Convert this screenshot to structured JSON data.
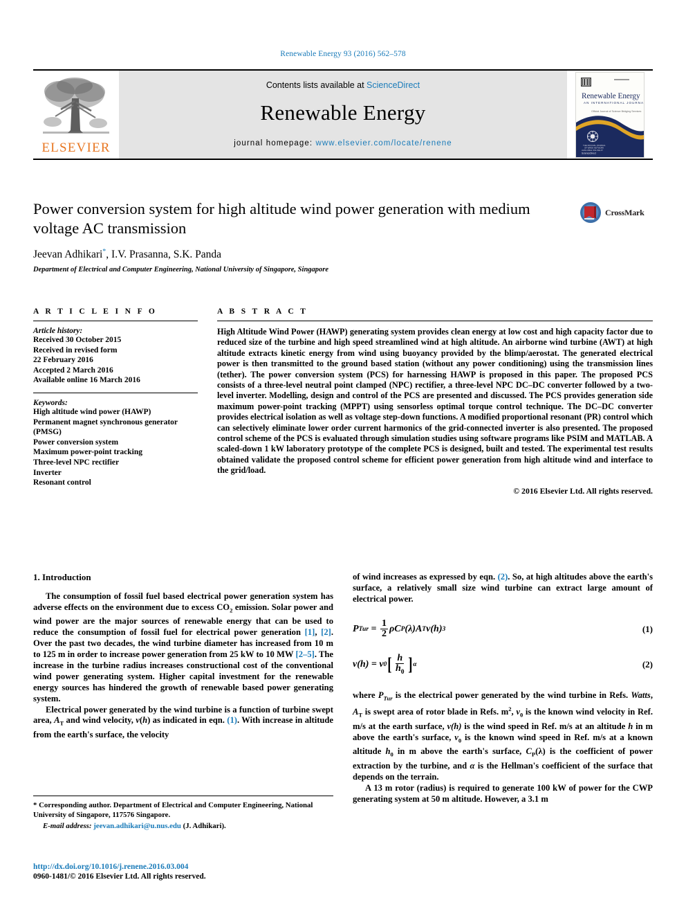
{
  "running_head": "Renewable Energy 93 (2016) 562–578",
  "masthead": {
    "contents_prefix": "Contents lists available at ",
    "sciencedirect": "ScienceDirect",
    "journal_title": "Renewable Energy",
    "homepage_prefix": "journal homepage: ",
    "homepage_url": "www.elsevier.com/locate/renene",
    "publisher_wordmark": "ELSEVIER",
    "cover": {
      "title": "Renewable Energy",
      "subtitle": "AN INTERNATIONAL JOURNAL",
      "tagline": "Official Journal of WREN — Science Bridging Services"
    }
  },
  "article": {
    "title": "Power conversion system for high altitude wind power generation with medium voltage AC transmission",
    "authors": "Jeevan Adhikari, I.V. Prasanna, S.K. Panda",
    "author_list": [
      {
        "name": "Jeevan Adhikari",
        "corresponding_marker": "*"
      },
      {
        "name": "I.V. Prasanna"
      },
      {
        "name": "S.K. Panda"
      }
    ],
    "affiliation": "Department of Electrical and Computer Engineering, National University of Singapore, Singapore",
    "crossmark_label": "CrossMark"
  },
  "article_info": {
    "heading": "A R T I C L E   I N F O",
    "history_heading": "Article history:",
    "history": [
      "Received 30 October 2015",
      "Received in revised form",
      "22 February 2016",
      "Accepted 2 March 2016",
      "Available online 16 March 2016"
    ],
    "keywords_heading": "Keywords:",
    "keywords": [
      "High altitude wind power (HAWP)",
      "Permanent magnet synchronous generator (PMSG)",
      "Power conversion system",
      "Maximum power-point tracking",
      "Three-level NPC rectifier",
      "Inverter",
      "Resonant control"
    ]
  },
  "abstract": {
    "heading": "A B S T R A C T",
    "text": "High Altitude Wind Power (HAWP) generating system provides clean energy at low cost and high capacity factor due to reduced size of the turbine and high speed streamlined wind at high altitude. An airborne wind turbine (AWT) at high altitude extracts kinetic energy from wind using buoyancy provided by the blimp/aerostat. The generated electrical power is then transmitted to the ground based station (without any power conditioning) using the transmission lines (tether). The power conversion system (PCS) for harnessing HAWP is proposed in this paper. The proposed PCS consists of a three-level neutral point clamped (NPC) rectifier, a three-level NPC DC–DC converter followed by a two-level inverter. Modelling, design and control of the PCS are presented and discussed. The PCS provides generation side maximum power-point tracking (MPPT) using sensorless optimal torque control technique. The DC–DC converter provides electrical isolation as well as voltage step-down functions. A modified proportional resonant (PR) control which can selectively eliminate lower order current harmonics of the grid-connected inverter is also presented. The proposed control scheme of the PCS is evaluated through simulation studies using software programs like PSIM and MATLAB. A scaled-down 1 kW laboratory prototype of the complete PCS is designed, built and tested. The experimental test results obtained validate the proposed control scheme for efficient power generation from high altitude wind and interface to the grid/load.",
    "copyright": "© 2016 Elsevier Ltd. All rights reserved."
  },
  "body": {
    "section_heading": "1. Introduction",
    "left_para_1_a": "The consumption of fossil fuel based electrical power generation system has adverse effects on the environment due to excess CO",
    "left_para_1_sub": "2",
    "left_para_1_b": " emission. Solar power and wind power are the major sources of renewable energy that can be used to reduce the consumption of fossil fuel for electrical power generation ",
    "ref_1": "[1]",
    "ref_sep": ", ",
    "ref_2": "[2]",
    "left_para_1_c": ". Over the past two decades, the wind turbine diameter has increased from 10 m to 125 m in order to increase power generation from 25 kW to 10 MW ",
    "ref_2_5": "[2–5]",
    "left_para_1_d": ". The increase in the turbine radius increases constructional cost of the conventional wind power generating system. Higher capital investment for the renewable energy sources has hindered the growth of renewable based power generating system.",
    "left_para_2_a": "Electrical power generated by the wind turbine is a function of turbine swept area, ",
    "left_para_2_b": " and wind velocity, ",
    "left_para_2_c": " as indicated in eqn. ",
    "ref_eq1": "(1)",
    "left_para_2_d": ". With increase in altitude from the earth's surface, the velocity",
    "right_para_1_a": "of wind increases as expressed by eqn. ",
    "ref_eq2": "(2)",
    "right_para_1_b": ". So, at high altitudes above the earth's surface, a relatively small size wind turbine can extract large amount of electrical power.",
    "right_para_where": "where P",
    "right_para_2": "A 13 m rotor (radius) is required to generate 100 kW of power for the CWP generating system at 50 m altitude. However, a 3.1 m"
  },
  "equations": [
    {
      "number": "(1)",
      "lhs": "P",
      "lhs_sub": "Tur",
      "rhs_text": "= ½ρC_P(λ)A_T v(h)³"
    },
    {
      "number": "(2)",
      "lhs": "v(h)",
      "rhs_text": "= v₀[h/h₀]^α"
    }
  ],
  "nomenclature": {
    "intro": "where ",
    "p_tur": "P",
    "p_tur_sub": "Tur",
    "t1": " is the electrical power generated by the wind turbine in Refs. ",
    "watts": "Watts",
    "t2": ", ",
    "a_t": "A",
    "a_t_sub": "T",
    "t3": " is swept area of rotor blade in Refs. m",
    "sup2": "2",
    "t4": ", ",
    "v0": "v",
    "v0_sub": "0",
    "t5": " is the known wind velocity in Ref. m/s at the earth surface, ",
    "vh": "v(h)",
    "t6": " is the wind speed in Ref. m/s at an altitude ",
    "h": "h",
    "t7": " in m above the earth's surface, ",
    "v0b": "v",
    "v0b_sub": "0",
    "t8": " is the known wind speed in Ref. m/s at a known altitude ",
    "h0": "h",
    "h0_sub": "0",
    "t9": " in m above the earth's surface, ",
    "cp": "C",
    "cp_sub": "P",
    "cp_arg": "(λ)",
    "t10": " is the coefficient of power extraction by the turbine, and ",
    "alpha": "α",
    "t11": " is the Hellman's coefficient of the surface that depends on the terrain."
  },
  "footnotes": {
    "corresponding": "* Corresponding author. Department of Electrical and Computer Engineering, National University of Singapore, 117576 Singapore.",
    "email_label": "E-mail address:",
    "email": "jeevan.adhikari@u.nus.edu",
    "email_owner": "(J. Adhikari).",
    "doi": "http://dx.doi.org/10.1016/j.renene.2016.03.004",
    "issn": "0960-1481/© 2016 Elsevier Ltd. All rights reserved."
  },
  "colors": {
    "link": "#1a7bb9",
    "elsevier_orange": "#e87722",
    "masthead_bg": "#e4e4e4",
    "cover_navy": "#1b2a5e",
    "cover_gold": "#e0a526"
  }
}
